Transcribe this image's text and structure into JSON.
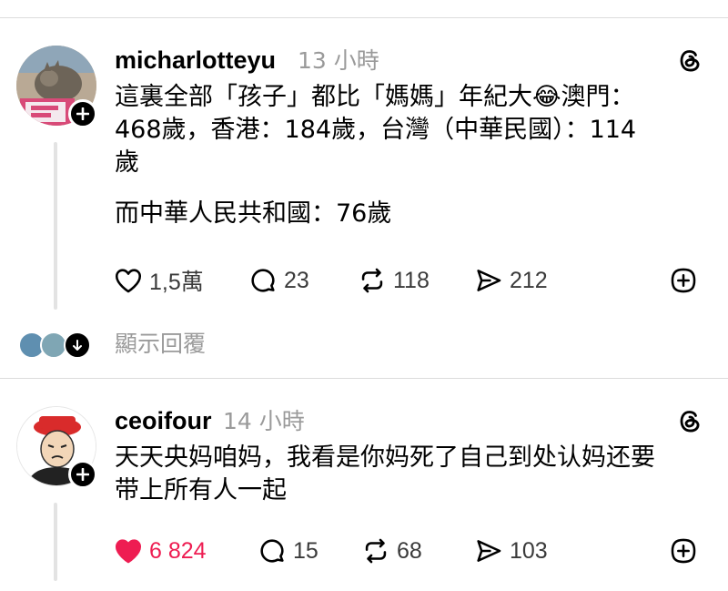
{
  "posts": [
    {
      "username": "micharlotteyu",
      "time": "13 小時",
      "lines": [
        "這裏全部「孩子」都比「媽媽」年紀大😂澳門：",
        "468歲，香港：184歲，台灣（中華民國）：114",
        "歲",
        "而中華人民共和國：76歲"
      ],
      "likes": "1,5萬",
      "replies": "23",
      "reposts": "118",
      "shares": "212",
      "liked": false
    },
    {
      "username": "ceoifour",
      "time": "14 小時",
      "lines": [
        "天天央妈咱妈，我看是你妈死了自己到处认妈还要",
        "带上所有人一起"
      ],
      "likes": "6 824",
      "replies": "15",
      "reposts": "68",
      "shares": "103",
      "liked": true
    }
  ],
  "show_replies_label": "顯示回覆",
  "colors": {
    "like_active": "#ee1d52",
    "muted": "#9a9a9a",
    "divider": "#dcdcdc"
  },
  "icons": [
    "threads-logo-icon",
    "heart-icon",
    "comment-icon",
    "repost-icon",
    "share-icon",
    "add-circle-icon",
    "follow-plus-icon",
    "chevron-down-icon"
  ]
}
